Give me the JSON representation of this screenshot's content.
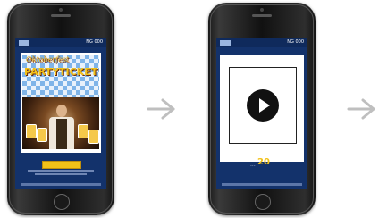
{
  "screens": [
    {
      "status_number": "NG 000",
      "banner_heading": "Oktoberfest",
      "banner_title": "PARTYTICKET",
      "button_label": ""
    },
    {
      "status_number": "NG 000",
      "score": "20",
      "score_prefix": "..."
    }
  ],
  "icons": {
    "arrow": "arrow-right-icon",
    "play": "play-icon"
  },
  "colors": {
    "screen_bg": "#13326b",
    "accent": "#f2c118",
    "arrow": "#bfbfbf"
  }
}
